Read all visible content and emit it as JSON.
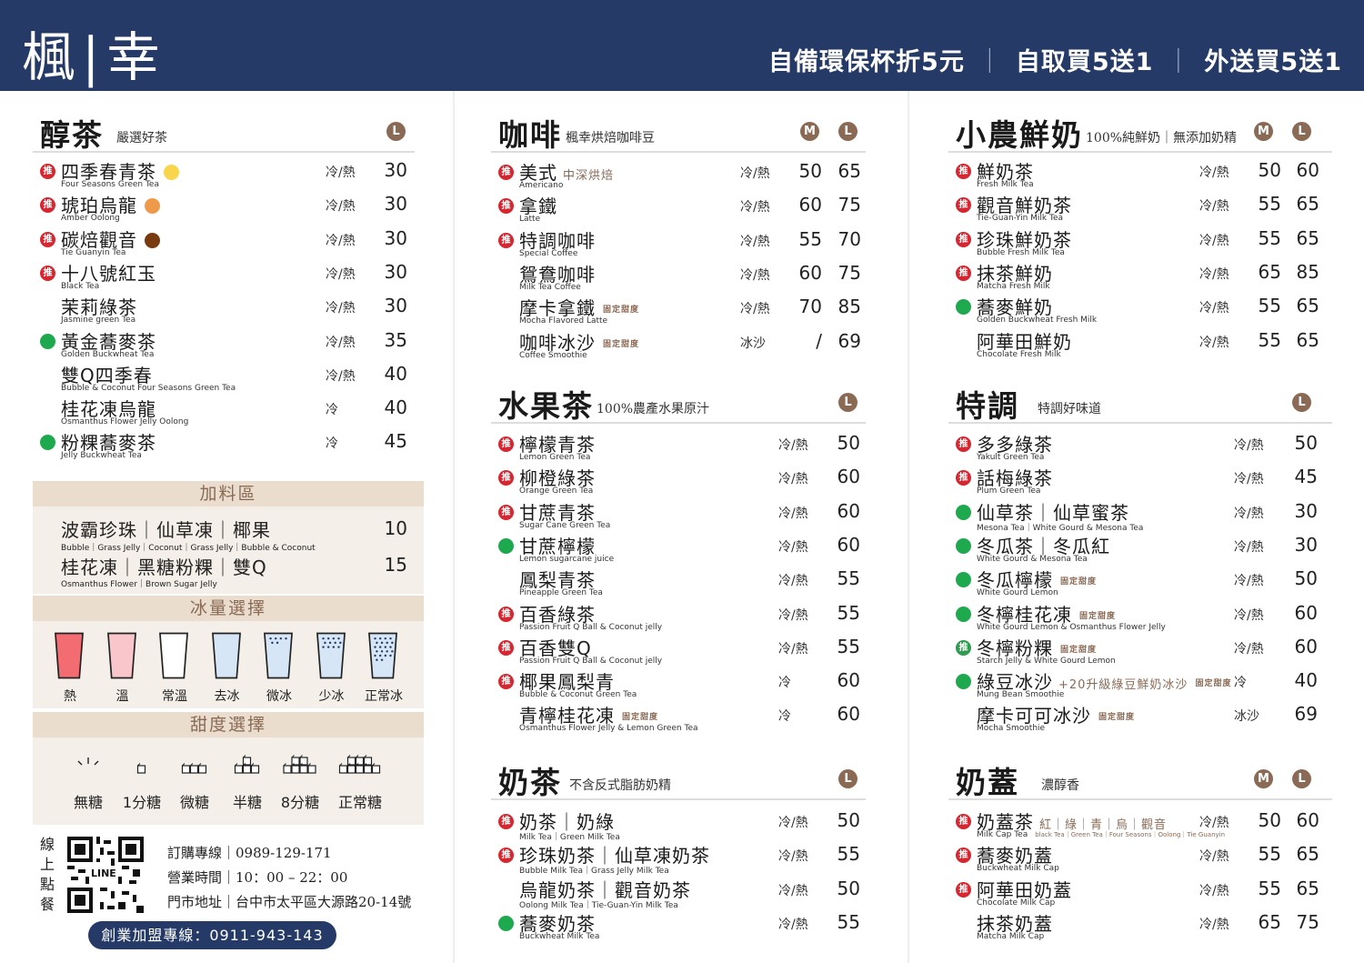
{
  "brand": "楓|幸",
  "promos": [
    "自備環保杯折5元",
    "自取買5送1",
    "外送買5送1"
  ],
  "badge_text": "推",
  "fixed_text": "固定甜度",
  "colors": {
    "navy": "#253A66",
    "accent": "#8A6A55",
    "red": "#D7262F",
    "green": "#1FA94F",
    "beige": "#F4EFE8"
  },
  "sections": {
    "chun_cha": {
      "title": "醇茶",
      "subtitle": "嚴選好茶",
      "sizes": [
        "L"
      ],
      "items": [
        {
          "name": "四季春青茶",
          "en": "Four Seasons Green Tea",
          "temp": "冷/熱",
          "prices": [
            "30"
          ],
          "mark": "rec",
          "dot": "#F8D54A"
        },
        {
          "name": "琥珀烏龍",
          "en": "Amber Oolong",
          "temp": "冷/熱",
          "prices": [
            "30"
          ],
          "mark": "rec",
          "dot": "#EF9A4A"
        },
        {
          "name": "碳焙觀音",
          "en": "Tie Guanyin Tea",
          "temp": "冷/熱",
          "prices": [
            "30"
          ],
          "mark": "rec",
          "dot": "#7A3A10"
        },
        {
          "name": "十八號紅玉",
          "en": "Black Tea",
          "temp": "冷/熱",
          "prices": [
            "30"
          ],
          "mark": "rec"
        },
        {
          "name": "茉莉綠茶",
          "en": "Jasmine green Tea",
          "temp": "冷/熱",
          "prices": [
            "30"
          ],
          "mark": "none"
        },
        {
          "name": "黃金蕎麥茶",
          "en": "Golden Buckwheat Tea",
          "temp": "冷/熱",
          "prices": [
            "35"
          ],
          "mark": "green"
        },
        {
          "name": "雙Q四季春",
          "en": "Bubble & Coconut Four Seasons Green Tea",
          "temp": "冷/熱",
          "prices": [
            "40"
          ],
          "mark": "none"
        },
        {
          "name": "桂花凍烏龍",
          "en": "Osmanthus Flower Jelly Oolong",
          "temp": "冷",
          "prices": [
            "40"
          ],
          "mark": "none"
        },
        {
          "name": "粉粿蕎麥茶",
          "en": "Jelly Buckwheat Tea",
          "temp": "冷",
          "prices": [
            "45"
          ],
          "mark": "green"
        }
      ]
    },
    "toppings": {
      "title": "加料區",
      "rows": [
        {
          "name": "波霸珍珠｜仙草凍｜椰果",
          "en": "Bubble｜Grass Jelly｜Coconut｜Grass Jelly｜Bubble & Coconut",
          "price": "10"
        },
        {
          "name": "桂花凍｜黑糖粉粿｜雙Q",
          "en": "Osmanthus Flower｜Brown Sugar Jelly",
          "price": "15"
        }
      ]
    },
    "ice": {
      "title": "冰量選擇",
      "levels": [
        {
          "label": "熱",
          "fill": "#F26C72",
          "dots": 0
        },
        {
          "label": "溫",
          "fill": "#F9C6CB",
          "dots": 0
        },
        {
          "label": "常溫",
          "fill": "#FFFFFF",
          "dots": 0
        },
        {
          "label": "去冰",
          "fill": "#D6E6F7",
          "dots": 0
        },
        {
          "label": "微冰",
          "fill": "#D6E6F7",
          "dots": 6
        },
        {
          "label": "少冰",
          "fill": "#D6E6F7",
          "dots": 12
        },
        {
          "label": "正常冰",
          "fill": "#D6E6F7",
          "dots": 22
        }
      ]
    },
    "sweet": {
      "title": "甜度選擇",
      "levels": [
        "無糖",
        "1分糖",
        "微糖",
        "半糖",
        "8分糖",
        "正常糖"
      ]
    },
    "contact": {
      "vertical": "線上點餐",
      "qr_text": "LINE",
      "lines": [
        "訂購專線｜0989-129-171",
        "營業時間｜10：00 – 22：00",
        "門市地址｜台中市太平區大源路20-14號"
      ],
      "franchise": "創業加盟專線：0911-943-143"
    },
    "coffee": {
      "title": "咖啡",
      "subtitle": "楓幸烘焙咖啡豆",
      "sizes": [
        "M",
        "L"
      ],
      "items": [
        {
          "name": "美式",
          "note": "中深烘焙",
          "en": "Americano",
          "temp": "冷/熱",
          "prices": [
            "50",
            "65"
          ],
          "mark": "rec"
        },
        {
          "name": "拿鐵",
          "en": "Latte",
          "temp": "冷/熱",
          "prices": [
            "60",
            "75"
          ],
          "mark": "rec"
        },
        {
          "name": "特調咖啡",
          "en": "Special Coffee",
          "temp": "冷/熱",
          "prices": [
            "55",
            "70"
          ],
          "mark": "rec"
        },
        {
          "name": "鴛鴦咖啡",
          "en": "Milk Tea Coffee",
          "temp": "冷/熱",
          "prices": [
            "60",
            "75"
          ],
          "mark": "none"
        },
        {
          "name": "摩卡拿鐵",
          "fixed": true,
          "en": "Mocha Flavored Latte",
          "temp": "冷/熱",
          "prices": [
            "70",
            "85"
          ],
          "mark": "none"
        },
        {
          "name": "咖啡冰沙",
          "fixed": true,
          "en": "Coffee Smoothie",
          "temp": "冰沙",
          "prices": [
            "/",
            "69"
          ],
          "mark": "none"
        }
      ]
    },
    "fruit": {
      "title": "水果茶",
      "subtitle": "100%農產水果原汁",
      "sizes": [
        "L"
      ],
      "items": [
        {
          "name": "檸檬青茶",
          "en": "Lemon Green Tea",
          "temp": "冷/熱",
          "prices": [
            "50"
          ],
          "mark": "rec"
        },
        {
          "name": "柳橙綠茶",
          "en": "Orange Green Tea",
          "temp": "冷/熱",
          "prices": [
            "60"
          ],
          "mark": "rec"
        },
        {
          "name": "甘蔗青茶",
          "en": "Sugar Cane Green Tea",
          "temp": "冷/熱",
          "prices": [
            "60"
          ],
          "mark": "rec"
        },
        {
          "name": "甘蔗檸檬",
          "en": "Lemon sugarcane juice",
          "temp": "冷/熱",
          "prices": [
            "60"
          ],
          "mark": "green"
        },
        {
          "name": "鳳梨青茶",
          "en": "Pineapple Green Tea",
          "temp": "冷/熱",
          "prices": [
            "55"
          ],
          "mark": "none"
        },
        {
          "name": "百香綠茶",
          "en": "Passion Fruit Q Ball & Coconut jelly",
          "temp": "冷/熱",
          "prices": [
            "55"
          ],
          "mark": "rec"
        },
        {
          "name": "百香雙Q",
          "en": "Passion Fruit Q Ball & Coconut jelly",
          "temp": "冷/熱",
          "prices": [
            "55"
          ],
          "mark": "rec"
        },
        {
          "name": "椰果鳳梨青",
          "en": "Bubble & Coconut Green Tea",
          "temp": "冷",
          "prices": [
            "60"
          ],
          "mark": "rec"
        },
        {
          "name": "青檸桂花凍",
          "fixed": true,
          "en": "Osmanthus Flower Jelly & Lemon Green Tea",
          "temp": "冷",
          "prices": [
            "60"
          ],
          "mark": "none"
        }
      ]
    },
    "milktea": {
      "title": "奶茶",
      "subtitle": "不含反式脂肪奶精",
      "sizes": [
        "L"
      ],
      "items": [
        {
          "name": "奶茶｜奶綠",
          "en": "Milk Tea｜Green Milk Tea",
          "temp": "冷/熱",
          "prices": [
            "50"
          ],
          "mark": "rec"
        },
        {
          "name": "珍珠奶茶｜仙草凍奶茶",
          "en": "Bubble Milk Tea｜Grass Jelly Milk Tea",
          "temp": "冷/熱",
          "prices": [
            "55"
          ],
          "mark": "rec"
        },
        {
          "name": "烏龍奶茶｜觀音奶茶",
          "en": "Oolong Milk Tea｜Tie-Guan-Yin Milk Tea",
          "temp": "冷/熱",
          "prices": [
            "50"
          ],
          "mark": "none"
        },
        {
          "name": "蕎麥奶茶",
          "en": "Buckwheat Milk Tea",
          "temp": "冷/熱",
          "prices": [
            "55"
          ],
          "mark": "green"
        }
      ]
    },
    "freshmilk": {
      "title": "小農鮮奶",
      "subtitle": "100%純鮮奶｜無添加奶精",
      "sizes": [
        "M",
        "L"
      ],
      "items": [
        {
          "name": "鮮奶茶",
          "en": "Fresh Milk Tea",
          "temp": "冷/熱",
          "prices": [
            "50",
            "60"
          ],
          "mark": "rec"
        },
        {
          "name": "觀音鮮奶茶",
          "en": "Tie-Guan-Yin Milk Tea",
          "temp": "冷/熱",
          "prices": [
            "55",
            "65"
          ],
          "mark": "rec"
        },
        {
          "name": "珍珠鮮奶茶",
          "en": "Bubble Fresh Milk Tea",
          "temp": "冷/熱",
          "prices": [
            "55",
            "65"
          ],
          "mark": "rec"
        },
        {
          "name": "抹茶鮮奶",
          "en": "Matcha Fresh Milk",
          "temp": "冷/熱",
          "prices": [
            "65",
            "85"
          ],
          "mark": "rec"
        },
        {
          "name": "蕎麥鮮奶",
          "en": "Golden Buckwheat Fresh Milk",
          "temp": "冷/熱",
          "prices": [
            "55",
            "65"
          ],
          "mark": "green"
        },
        {
          "name": "阿華田鮮奶",
          "en": "Chocolate Fresh Milk",
          "temp": "冷/熱",
          "prices": [
            "55",
            "65"
          ],
          "mark": "none"
        }
      ]
    },
    "special": {
      "title": "特調",
      "subtitle": "特調好味道",
      "sizes": [
        "L"
      ],
      "items": [
        {
          "name": "多多綠茶",
          "en": "Yakult Green Tea",
          "temp": "冷/熱",
          "prices": [
            "50"
          ],
          "mark": "rec"
        },
        {
          "name": "話梅綠茶",
          "en": "Plum Green Tea",
          "temp": "冷/熱",
          "prices": [
            "45"
          ],
          "mark": "rec"
        },
        {
          "name": "仙草茶｜仙草蜜茶",
          "en": "Mesona Tea｜White Gourd & Mesona Tea",
          "temp": "冷/熱",
          "prices": [
            "30"
          ],
          "mark": "green"
        },
        {
          "name": "冬瓜茶｜冬瓜紅",
          "en": "White Gourd & Mesona Tea",
          "temp": "冷/熱",
          "prices": [
            "30"
          ],
          "mark": "green"
        },
        {
          "name": "冬瓜檸檬",
          "fixed": true,
          "en": "White Gourd Lemon",
          "temp": "冷/熱",
          "prices": [
            "50"
          ],
          "mark": "green"
        },
        {
          "name": "冬檸桂花凍",
          "fixed": true,
          "en": "White Gourd Lemon & Osmanthus Flower Jelly",
          "temp": "冷/熱",
          "prices": [
            "60"
          ],
          "mark": "green"
        },
        {
          "name": "冬檸粉粿",
          "fixed": true,
          "en": "Starch Jelly & White Gourd Lemon",
          "temp": "冷/熱",
          "prices": [
            "60"
          ],
          "mark": "recgreen"
        },
        {
          "name": "綠豆冰沙",
          "note": "+20升級綠豆鮮奶冰沙",
          "fixed": true,
          "en": "Mung Bean Smoothie",
          "temp": "冷",
          "prices": [
            "40"
          ],
          "mark": "green"
        },
        {
          "name": "摩卡可可冰沙",
          "fixed": true,
          "en": "Mocha Smoothie",
          "temp": "冰沙",
          "prices": [
            "69"
          ],
          "mark": "none"
        }
      ]
    },
    "milkcap": {
      "title": "奶蓋",
      "subtitle": "濃醇香",
      "sizes": [
        "M",
        "L"
      ],
      "items": [
        {
          "name": "奶蓋茶",
          "note": "紅｜綠｜青｜烏｜觀音",
          "en": "Milk Cap Tea",
          "en2": "black Tea｜Green Tea｜Four Seasons｜Oolong｜Tie Guanyin",
          "temp": "冷/熱",
          "prices": [
            "50",
            "60"
          ],
          "mark": "rec"
        },
        {
          "name": "蕎麥奶蓋",
          "en": "Buckwheat Milk Cap",
          "temp": "冷/熱",
          "prices": [
            "55",
            "65"
          ],
          "mark": "rec"
        },
        {
          "name": "阿華田奶蓋",
          "en": "Chocolate Milk Cap",
          "temp": "冷/熱",
          "prices": [
            "55",
            "65"
          ],
          "mark": "rec"
        },
        {
          "name": "抹茶奶蓋",
          "en": "Matcha Milk Cap",
          "temp": "冷/熱",
          "prices": [
            "65",
            "75"
          ],
          "mark": "none"
        }
      ]
    }
  }
}
